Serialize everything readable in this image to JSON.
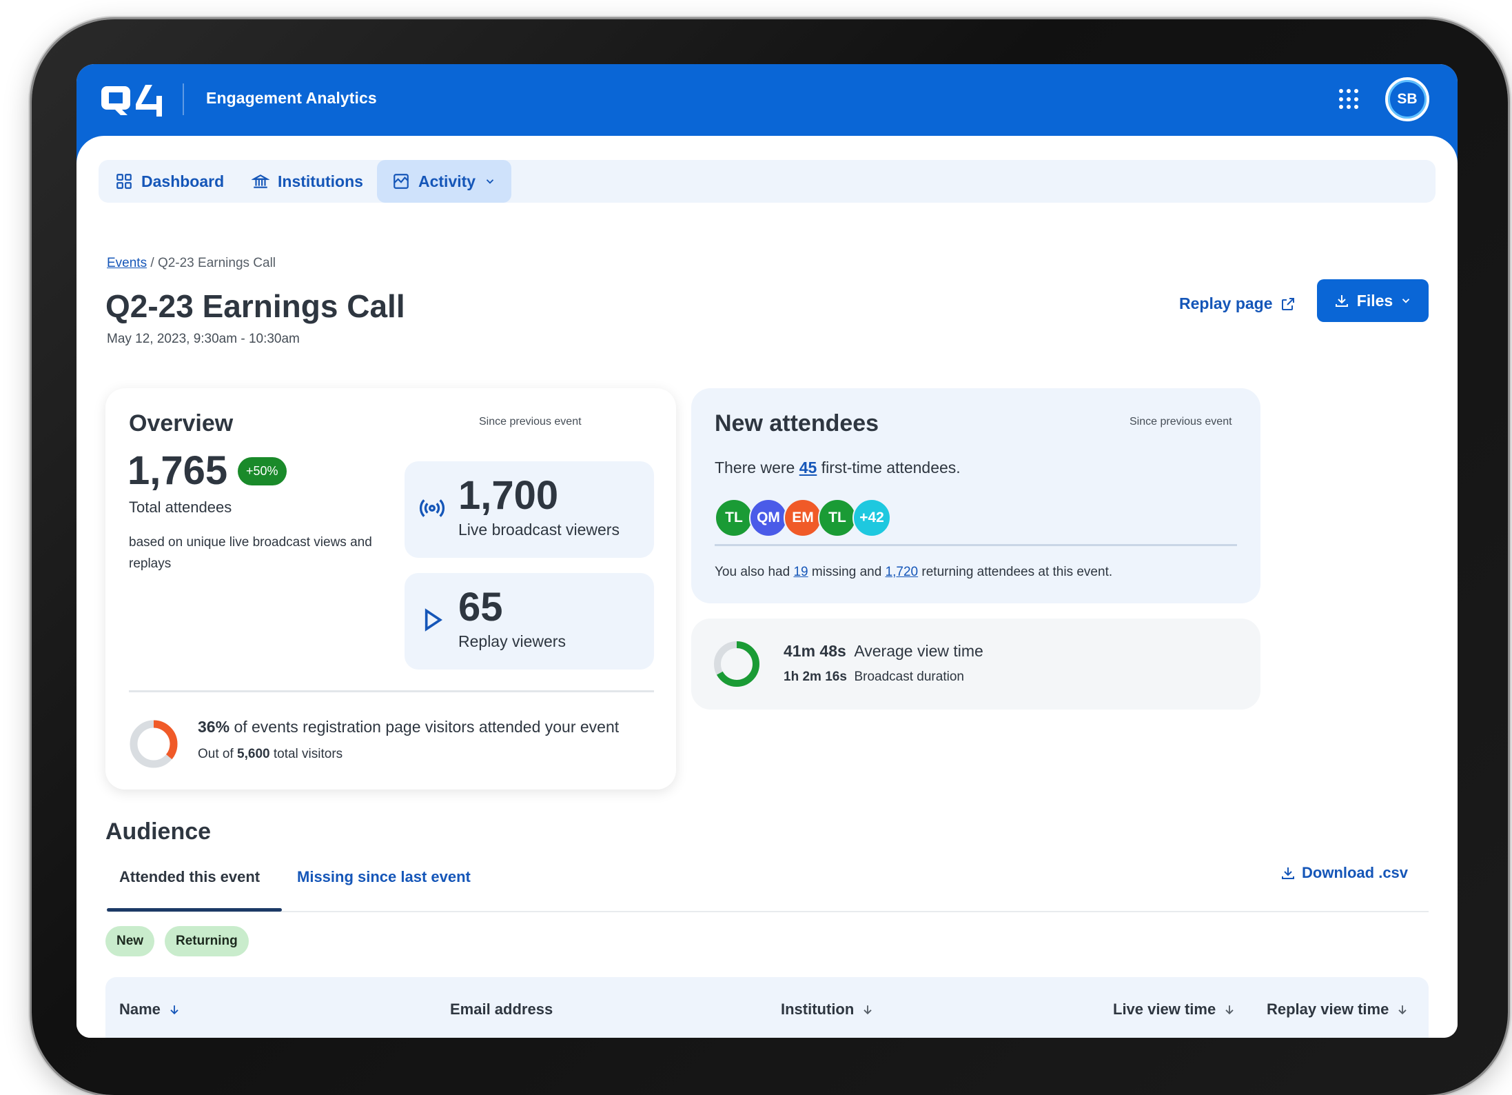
{
  "header": {
    "logo_text": "Q4",
    "app_name": "Engagement Analytics",
    "user_initials": "SB"
  },
  "nav": {
    "dashboard": "Dashboard",
    "institutions": "Institutions",
    "activity": "Activity"
  },
  "breadcrumb": {
    "parent": "Events",
    "separator": "/",
    "current": "Q2-23 Earnings Call"
  },
  "page": {
    "title": "Q2-23 Earnings Call",
    "date": "May 12, 2023, 9:30am - 10:30am",
    "replay_label": "Replay page",
    "files_label": "Files"
  },
  "overview": {
    "title": "Overview",
    "since": "Since previous event",
    "total": "1,765",
    "change": "+50%",
    "total_label": "Total attendees",
    "note": "based on unique live broadcast views and replays",
    "live_value": "1,700",
    "live_label": "Live broadcast viewers",
    "replay_value": "65",
    "replay_label": "Replay viewers",
    "reg_percent": "36%",
    "reg_text": "of events registration page visitors attended your event",
    "reg_percent_value": 0.36,
    "visitors_prefix": "Out of",
    "visitors_value": "5,600",
    "visitors_suffix": "total visitors"
  },
  "new_attendees": {
    "title": "New attendees",
    "since": "Since previous event",
    "prefix": "There were",
    "count": "45",
    "suffix": "first-time attendees.",
    "avatars": [
      {
        "initials": "TL",
        "color": "#1a9b35"
      },
      {
        "initials": "QM",
        "color": "#4a5be8"
      },
      {
        "initials": "EM",
        "color": "#f05a28"
      },
      {
        "initials": "TL",
        "color": "#1a9b35"
      },
      {
        "initials": "+42",
        "color": "#1ec8df"
      }
    ],
    "also_prefix": "You also had",
    "missing": "19",
    "also_middle": "missing and",
    "returning": "1,720",
    "also_suffix": "returning attendees at this event."
  },
  "view_time": {
    "avg_value": "41m 48s",
    "avg_label": "Average view time",
    "duration_value": "1h 2m 16s",
    "duration_label": "Broadcast duration",
    "ratio": 0.67
  },
  "audience": {
    "title": "Audience",
    "tab_attended": "Attended this event",
    "tab_missing": "Missing since last event",
    "download": "Download .csv",
    "chip_new": "New",
    "chip_returning": "Returning",
    "columns": [
      "Name",
      "Email address",
      "Institution",
      "Live view time",
      "Replay view time"
    ]
  },
  "colors": {
    "brand": "#0a66d6",
    "link": "#1556b8",
    "positive": "#1a8a2a",
    "donut_orange": "#f05a28",
    "donut_green": "#1a9b35"
  }
}
